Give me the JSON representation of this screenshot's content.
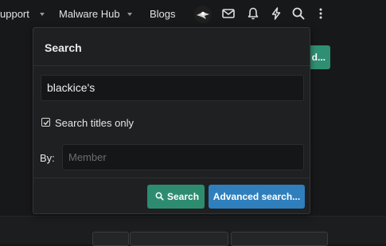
{
  "nav": {
    "items": [
      "upport",
      "Malware Hub",
      "Blogs"
    ],
    "icons": [
      "avatar",
      "envelope-icon",
      "bell-icon",
      "lightning-icon",
      "search-icon",
      "more-vertical-icon"
    ]
  },
  "background_button_label": "d...",
  "search_popup": {
    "title": "Search",
    "query_value": "blackice's",
    "titles_only_label": "Search titles only",
    "titles_only_checked": true,
    "by_label": "By:",
    "member_placeholder": "Member",
    "search_button_label": "Search",
    "advanced_button_label": "Advanced search..."
  },
  "colors": {
    "background": "#17181a",
    "popup": "#1f2022",
    "search_button": "#2d8c6f",
    "advanced_button": "#2f7fbd"
  }
}
